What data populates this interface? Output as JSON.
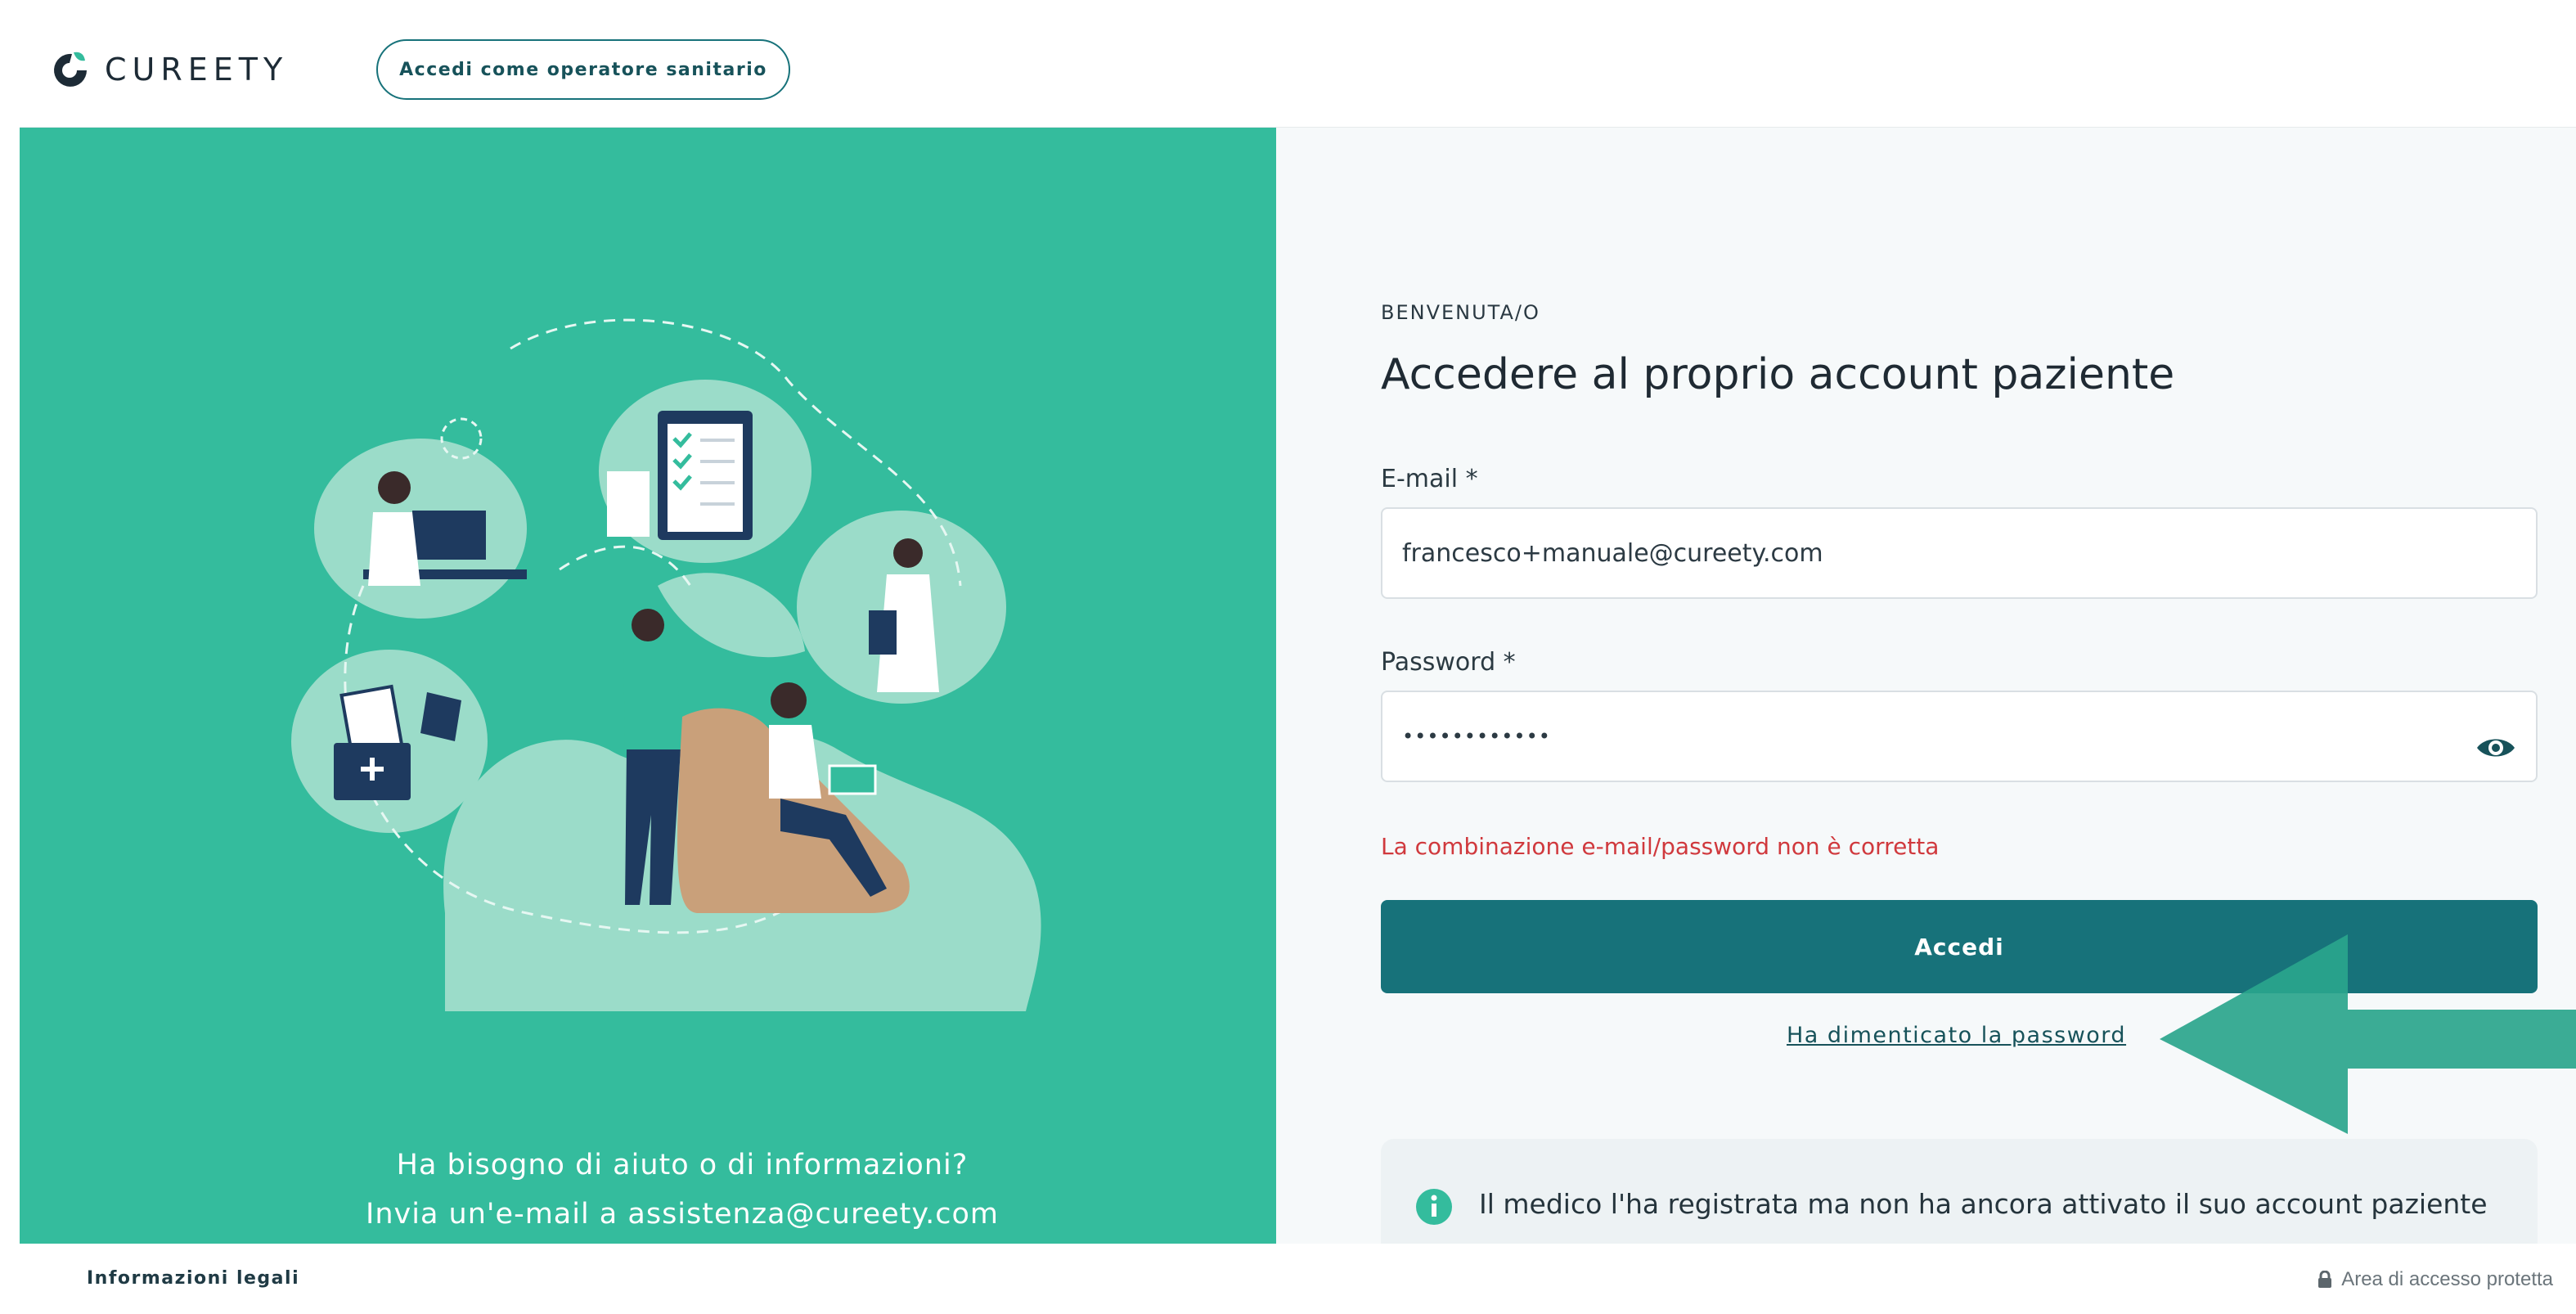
{
  "header": {
    "brand": "CUREETY",
    "hc_login_label": "Accedi come operatore sanitario"
  },
  "left": {
    "help_line1": "Ha bisogno di aiuto o di informazioni?",
    "help_line2": "Invia un'e-mail a assistenza@cureety.com"
  },
  "form": {
    "welcome": "BENVENUTA/O",
    "title": "Accedere al proprio account paziente",
    "email_label": "E-mail *",
    "email_value": "francesco+manuale@cureety.com",
    "password_label": "Password *",
    "password_value": "••••••••••••",
    "error": "La combinazione e-mail/password non è corretta",
    "submit_label": "Accedi",
    "forgot_label": "Ha dimenticato la password",
    "info_text": "Il medico l'ha registrata ma non ha ancora attivato il suo account paziente"
  },
  "footer": {
    "legal": "Informazioni legali",
    "secure": "Area di accesso protetta"
  },
  "colors": {
    "brand_green": "#34bc9d",
    "primary_teal": "#17727a",
    "error_red": "#d0393d",
    "annotation_arrow": "#2aa58c"
  },
  "icons": [
    "cureety-logo-icon",
    "eye-icon",
    "info-icon",
    "lock-icon",
    "arrow-annotation"
  ]
}
